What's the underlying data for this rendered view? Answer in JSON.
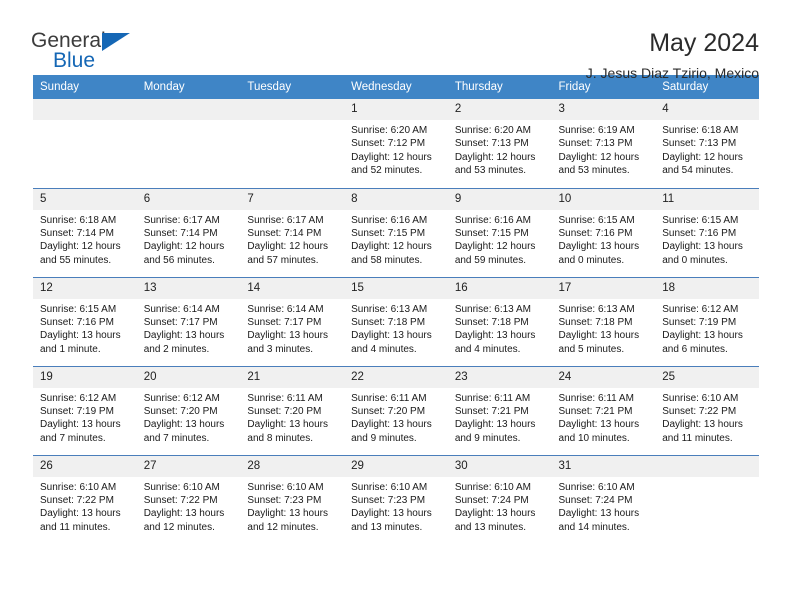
{
  "logo": {
    "word_top": "General",
    "word_bottom": "Blue",
    "triangle_icon": "triangle-icon",
    "brand_color": "#1567b5"
  },
  "header": {
    "title": "May 2024",
    "subtitle": "J. Jesus Diaz Tzirio, Mexico"
  },
  "theme": {
    "header_row_bg": "#3f85c6",
    "daynum_bg": "#f0f0f0",
    "grid_line": "#4a7ebb"
  },
  "weekdays": [
    "Sunday",
    "Monday",
    "Tuesday",
    "Wednesday",
    "Thursday",
    "Friday",
    "Saturday"
  ],
  "labels": {
    "sunrise": "Sunrise:",
    "sunset": "Sunset:",
    "daylight": "Daylight:"
  },
  "weeks": [
    [
      {
        "day": "",
        "empty": true
      },
      {
        "day": "",
        "empty": true
      },
      {
        "day": "",
        "empty": true
      },
      {
        "day": "1",
        "sunrise": "Sunrise: 6:20 AM",
        "sunset": "Sunset: 7:12 PM",
        "daylight1": "Daylight: 12 hours",
        "daylight2": "and 52 minutes."
      },
      {
        "day": "2",
        "sunrise": "Sunrise: 6:20 AM",
        "sunset": "Sunset: 7:13 PM",
        "daylight1": "Daylight: 12 hours",
        "daylight2": "and 53 minutes."
      },
      {
        "day": "3",
        "sunrise": "Sunrise: 6:19 AM",
        "sunset": "Sunset: 7:13 PM",
        "daylight1": "Daylight: 12 hours",
        "daylight2": "and 53 minutes."
      },
      {
        "day": "4",
        "sunrise": "Sunrise: 6:18 AM",
        "sunset": "Sunset: 7:13 PM",
        "daylight1": "Daylight: 12 hours",
        "daylight2": "and 54 minutes."
      }
    ],
    [
      {
        "day": "5",
        "sunrise": "Sunrise: 6:18 AM",
        "sunset": "Sunset: 7:14 PM",
        "daylight1": "Daylight: 12 hours",
        "daylight2": "and 55 minutes."
      },
      {
        "day": "6",
        "sunrise": "Sunrise: 6:17 AM",
        "sunset": "Sunset: 7:14 PM",
        "daylight1": "Daylight: 12 hours",
        "daylight2": "and 56 minutes."
      },
      {
        "day": "7",
        "sunrise": "Sunrise: 6:17 AM",
        "sunset": "Sunset: 7:14 PM",
        "daylight1": "Daylight: 12 hours",
        "daylight2": "and 57 minutes."
      },
      {
        "day": "8",
        "sunrise": "Sunrise: 6:16 AM",
        "sunset": "Sunset: 7:15 PM",
        "daylight1": "Daylight: 12 hours",
        "daylight2": "and 58 minutes."
      },
      {
        "day": "9",
        "sunrise": "Sunrise: 6:16 AM",
        "sunset": "Sunset: 7:15 PM",
        "daylight1": "Daylight: 12 hours",
        "daylight2": "and 59 minutes."
      },
      {
        "day": "10",
        "sunrise": "Sunrise: 6:15 AM",
        "sunset": "Sunset: 7:16 PM",
        "daylight1": "Daylight: 13 hours",
        "daylight2": "and 0 minutes."
      },
      {
        "day": "11",
        "sunrise": "Sunrise: 6:15 AM",
        "sunset": "Sunset: 7:16 PM",
        "daylight1": "Daylight: 13 hours",
        "daylight2": "and 0 minutes."
      }
    ],
    [
      {
        "day": "12",
        "sunrise": "Sunrise: 6:15 AM",
        "sunset": "Sunset: 7:16 PM",
        "daylight1": "Daylight: 13 hours",
        "daylight2": "and 1 minute."
      },
      {
        "day": "13",
        "sunrise": "Sunrise: 6:14 AM",
        "sunset": "Sunset: 7:17 PM",
        "daylight1": "Daylight: 13 hours",
        "daylight2": "and 2 minutes."
      },
      {
        "day": "14",
        "sunrise": "Sunrise: 6:14 AM",
        "sunset": "Sunset: 7:17 PM",
        "daylight1": "Daylight: 13 hours",
        "daylight2": "and 3 minutes."
      },
      {
        "day": "15",
        "sunrise": "Sunrise: 6:13 AM",
        "sunset": "Sunset: 7:18 PM",
        "daylight1": "Daylight: 13 hours",
        "daylight2": "and 4 minutes."
      },
      {
        "day": "16",
        "sunrise": "Sunrise: 6:13 AM",
        "sunset": "Sunset: 7:18 PM",
        "daylight1": "Daylight: 13 hours",
        "daylight2": "and 4 minutes."
      },
      {
        "day": "17",
        "sunrise": "Sunrise: 6:13 AM",
        "sunset": "Sunset: 7:18 PM",
        "daylight1": "Daylight: 13 hours",
        "daylight2": "and 5 minutes."
      },
      {
        "day": "18",
        "sunrise": "Sunrise: 6:12 AM",
        "sunset": "Sunset: 7:19 PM",
        "daylight1": "Daylight: 13 hours",
        "daylight2": "and 6 minutes."
      }
    ],
    [
      {
        "day": "19",
        "sunrise": "Sunrise: 6:12 AM",
        "sunset": "Sunset: 7:19 PM",
        "daylight1": "Daylight: 13 hours",
        "daylight2": "and 7 minutes."
      },
      {
        "day": "20",
        "sunrise": "Sunrise: 6:12 AM",
        "sunset": "Sunset: 7:20 PM",
        "daylight1": "Daylight: 13 hours",
        "daylight2": "and 7 minutes."
      },
      {
        "day": "21",
        "sunrise": "Sunrise: 6:11 AM",
        "sunset": "Sunset: 7:20 PM",
        "daylight1": "Daylight: 13 hours",
        "daylight2": "and 8 minutes."
      },
      {
        "day": "22",
        "sunrise": "Sunrise: 6:11 AM",
        "sunset": "Sunset: 7:20 PM",
        "daylight1": "Daylight: 13 hours",
        "daylight2": "and 9 minutes."
      },
      {
        "day": "23",
        "sunrise": "Sunrise: 6:11 AM",
        "sunset": "Sunset: 7:21 PM",
        "daylight1": "Daylight: 13 hours",
        "daylight2": "and 9 minutes."
      },
      {
        "day": "24",
        "sunrise": "Sunrise: 6:11 AM",
        "sunset": "Sunset: 7:21 PM",
        "daylight1": "Daylight: 13 hours",
        "daylight2": "and 10 minutes."
      },
      {
        "day": "25",
        "sunrise": "Sunrise: 6:10 AM",
        "sunset": "Sunset: 7:22 PM",
        "daylight1": "Daylight: 13 hours",
        "daylight2": "and 11 minutes."
      }
    ],
    [
      {
        "day": "26",
        "sunrise": "Sunrise: 6:10 AM",
        "sunset": "Sunset: 7:22 PM",
        "daylight1": "Daylight: 13 hours",
        "daylight2": "and 11 minutes."
      },
      {
        "day": "27",
        "sunrise": "Sunrise: 6:10 AM",
        "sunset": "Sunset: 7:22 PM",
        "daylight1": "Daylight: 13 hours",
        "daylight2": "and 12 minutes."
      },
      {
        "day": "28",
        "sunrise": "Sunrise: 6:10 AM",
        "sunset": "Sunset: 7:23 PM",
        "daylight1": "Daylight: 13 hours",
        "daylight2": "and 12 minutes."
      },
      {
        "day": "29",
        "sunrise": "Sunrise: 6:10 AM",
        "sunset": "Sunset: 7:23 PM",
        "daylight1": "Daylight: 13 hours",
        "daylight2": "and 13 minutes."
      },
      {
        "day": "30",
        "sunrise": "Sunrise: 6:10 AM",
        "sunset": "Sunset: 7:24 PM",
        "daylight1": "Daylight: 13 hours",
        "daylight2": "and 13 minutes."
      },
      {
        "day": "31",
        "sunrise": "Sunrise: 6:10 AM",
        "sunset": "Sunset: 7:24 PM",
        "daylight1": "Daylight: 13 hours",
        "daylight2": "and 14 minutes."
      },
      {
        "day": "",
        "empty": true
      }
    ]
  ]
}
